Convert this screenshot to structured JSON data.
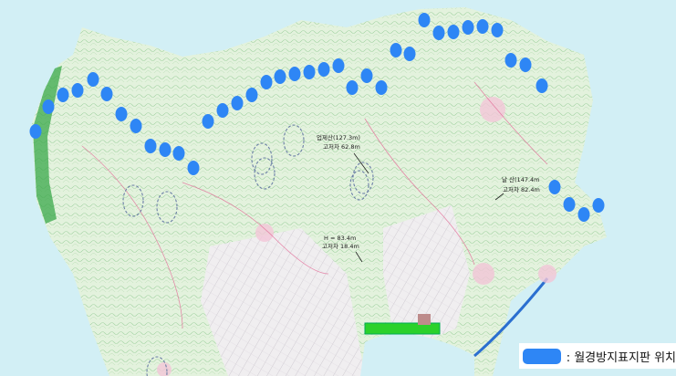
{
  "map": {
    "annotations": [
      {
        "id": "peak-1-name",
        "text": "업제산(127.3m)"
      },
      {
        "id": "peak-1-diff",
        "text": "고저차 62.8m"
      },
      {
        "id": "peak-2-name",
        "text": "날 산(147.4m"
      },
      {
        "id": "peak-2-diff",
        "text": "고저차 82.4m"
      },
      {
        "id": "elev-h",
        "text": "H = 83.4m"
      },
      {
        "id": "elev-diff",
        "text": "고저차 18.4m"
      }
    ],
    "marker_color": "#2e86f5",
    "marker_count": 46,
    "dashed_circle_count": 8
  },
  "legend": {
    "label": ": 월경방지표지판 위치",
    "swatch_color": "#2e86f5"
  }
}
